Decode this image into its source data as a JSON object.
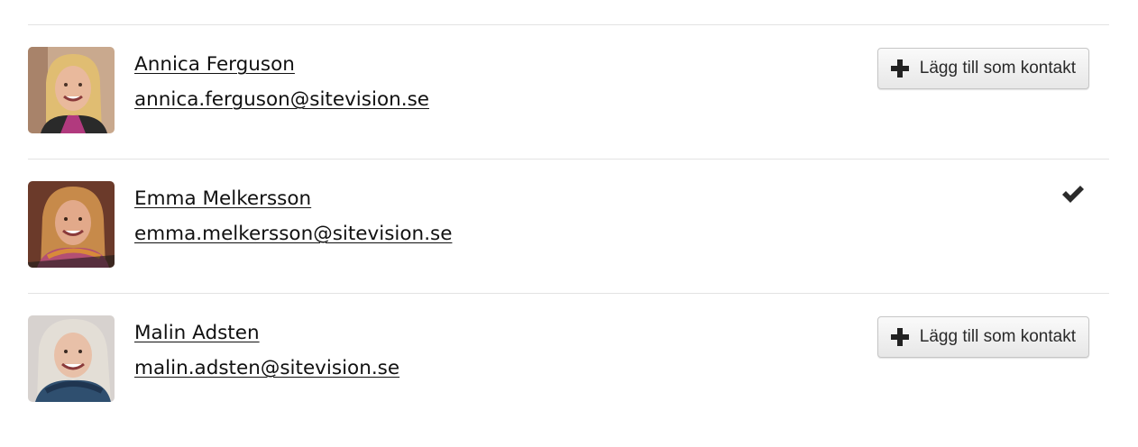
{
  "contacts": [
    {
      "name": "Annica Ferguson",
      "email": "annica.ferguson@sitevision.se",
      "action": "add",
      "action_label": "Lägg till som kontakt",
      "avatar_colors": {
        "bg": "#c9a98e",
        "hair": "#e0bd72",
        "face": "#e9b99c",
        "top": "#b13a7e"
      }
    },
    {
      "name": "Emma Melkersson",
      "email": "emma.melkersson@sitevision.se",
      "action": "added",
      "action_icon": "checkmark-icon",
      "avatar_colors": {
        "bg": "#6b3a2a",
        "hair": "#c78a4a",
        "face": "#e2a98a",
        "top": "#b34f73"
      }
    },
    {
      "name": "Malin Adsten",
      "email": "malin.adsten@sitevision.se",
      "action": "add",
      "action_label": "Lägg till som kontakt",
      "avatar_colors": {
        "bg": "#d7d2cf",
        "hair": "#d9d4cc",
        "face": "#e8c0a8",
        "top": "#2f4f6f"
      }
    }
  ],
  "colors": {
    "link": "#111111",
    "divider": "#e3e3e3",
    "button_border": "#c6c6c6",
    "icon": "#222222"
  }
}
